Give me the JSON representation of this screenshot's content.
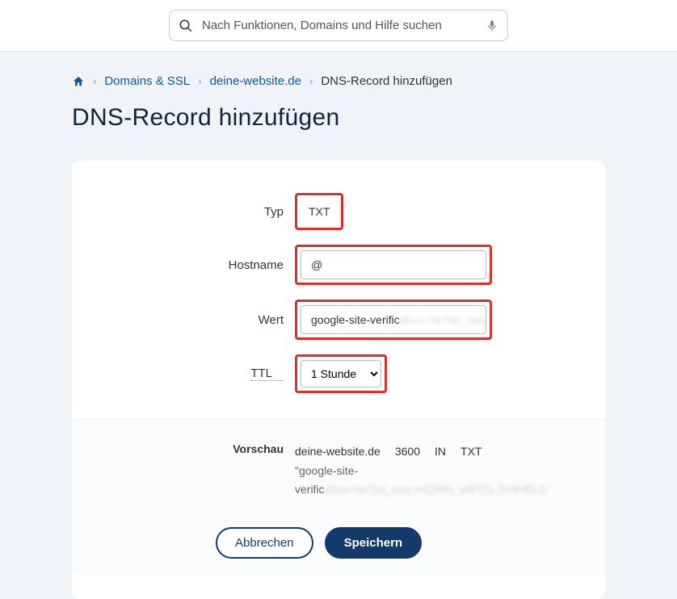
{
  "search": {
    "placeholder": "Nach Funktionen, Domains und Hilfe suchen"
  },
  "breadcrumb": {
    "items": [
      "Domains & SSL",
      "deine-website.de",
      "DNS-Record hinzufügen"
    ]
  },
  "page": {
    "title": "DNS-Record hinzufügen"
  },
  "form": {
    "typ_label": "Typ",
    "typ_value": "TXT",
    "hostname_label": "Hostname",
    "hostname_value": "@",
    "wert_label": "Wert",
    "wert_visible": "google-site-verific",
    "wert_hidden": "ation=hk7txt_swy",
    "ttl_label": "TTL",
    "ttl_value": "1 Stunde"
  },
  "preview": {
    "label": "Vorschau",
    "domain": "deine-website.de",
    "ttl_seconds": "3600",
    "class": "IN",
    "type": "TXT",
    "value_visible": "\"google-site-verific",
    "value_hidden": "ation=hk7txt_swy=HQtMs_wtPCS.TcHHBLS\""
  },
  "buttons": {
    "cancel": "Abbrechen",
    "save": "Speichern"
  }
}
